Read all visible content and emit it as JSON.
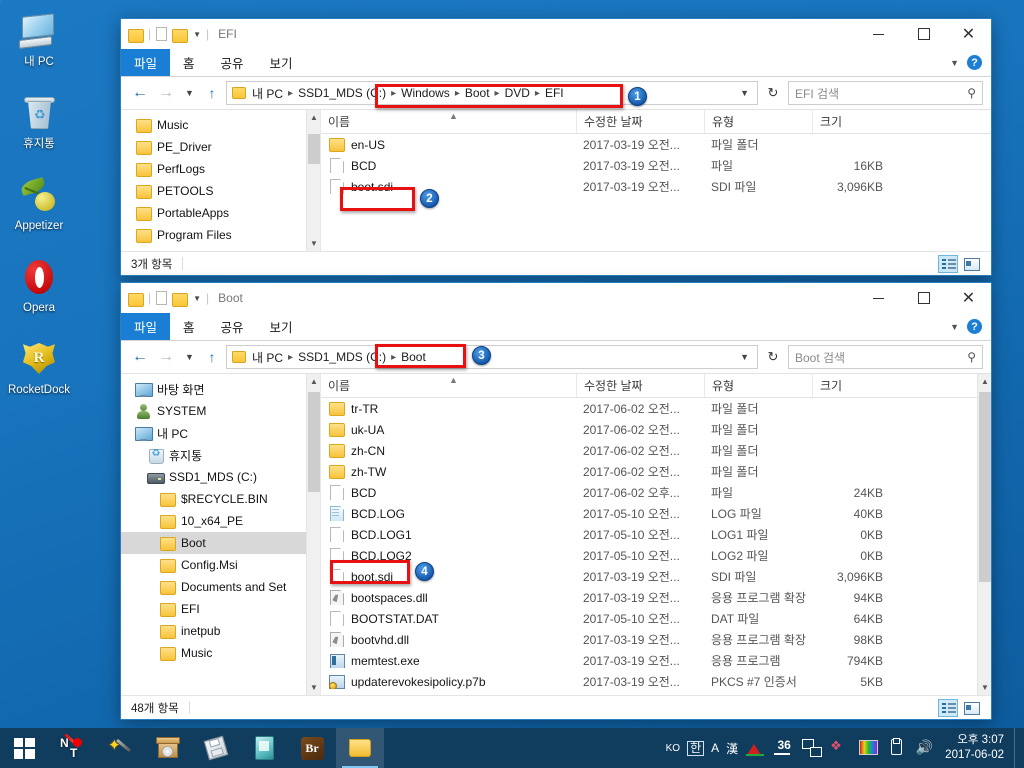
{
  "desktop": {
    "icons": [
      {
        "label": "내 PC",
        "icon": "my-computer-icon"
      },
      {
        "label": "휴지통",
        "icon": "recycle-bin-icon"
      },
      {
        "label": "Appetizer",
        "icon": "appetizer-icon"
      },
      {
        "label": "Opera",
        "icon": "opera-icon"
      },
      {
        "label": "RocketDock",
        "icon": "rocketdock-icon"
      }
    ]
  },
  "ribbon_tabs": [
    "파일",
    "홈",
    "공유",
    "보기"
  ],
  "window_efi": {
    "title": "EFI",
    "search_placeholder": "EFI 검색",
    "breadcrumb": [
      "내 PC",
      "SSD1_MDS (C:)",
      "Windows",
      "Boot",
      "DVD",
      "EFI"
    ],
    "columns": [
      "이름",
      "수정한 날짜",
      "유형",
      "크기"
    ],
    "nav_items": [
      {
        "label": "Music",
        "icon": "folder-icon"
      },
      {
        "label": "PE_Driver",
        "icon": "folder-icon"
      },
      {
        "label": "PerfLogs",
        "icon": "folder-icon"
      },
      {
        "label": "PETOOLS",
        "icon": "folder-icon"
      },
      {
        "label": "PortableApps",
        "icon": "folder-icon"
      },
      {
        "label": "Program Files",
        "icon": "folder-icon"
      }
    ],
    "files": [
      {
        "name": "en-US",
        "date": "2017-03-19 오전...",
        "type": "파일 폴더",
        "size": "",
        "icon": "folder-icon"
      },
      {
        "name": "BCD",
        "date": "2017-03-19 오전...",
        "type": "파일",
        "size": "16KB",
        "icon": "file-icon"
      },
      {
        "name": "boot.sdi",
        "date": "2017-03-19 오전...",
        "type": "SDI 파일",
        "size": "3,096KB",
        "icon": "file-icon"
      }
    ],
    "status": "3개 항목"
  },
  "window_boot": {
    "title": "Boot",
    "search_placeholder": "Boot 검색",
    "breadcrumb": [
      "내 PC",
      "SSD1_MDS (C:)",
      "Boot"
    ],
    "columns": [
      "이름",
      "수정한 날짜",
      "유형",
      "크기"
    ],
    "tree": [
      {
        "label": "바탕 화면",
        "icon": "desktop-icon",
        "indent": 1,
        "selected": false
      },
      {
        "label": "SYSTEM",
        "icon": "user-icon",
        "indent": 1,
        "selected": false
      },
      {
        "label": "내 PC",
        "icon": "my-computer-icon",
        "indent": 1,
        "selected": false
      },
      {
        "label": "휴지통",
        "icon": "recycle-bin-icon",
        "indent": 2,
        "selected": false
      },
      {
        "label": "SSD1_MDS (C:)",
        "icon": "drive-icon",
        "indent": 2,
        "selected": false
      },
      {
        "label": "$RECYCLE.BIN",
        "icon": "folder-icon",
        "indent": 3,
        "selected": false
      },
      {
        "label": "10_x64_PE",
        "icon": "folder-icon",
        "indent": 3,
        "selected": false
      },
      {
        "label": "Boot",
        "icon": "folder-icon",
        "indent": 3,
        "selected": true
      },
      {
        "label": "Config.Msi",
        "icon": "folder-icon",
        "indent": 3,
        "selected": false
      },
      {
        "label": "Documents and Set",
        "icon": "folder-icon",
        "indent": 3,
        "selected": false
      },
      {
        "label": "EFI",
        "icon": "folder-icon",
        "indent": 3,
        "selected": false
      },
      {
        "label": "inetpub",
        "icon": "folder-icon",
        "indent": 3,
        "selected": false
      },
      {
        "label": "Music",
        "icon": "folder-icon",
        "indent": 3,
        "selected": false
      }
    ],
    "files": [
      {
        "name": "tr-TR",
        "date": "2017-06-02 오전...",
        "type": "파일 폴더",
        "size": "",
        "icon": "folder-icon"
      },
      {
        "name": "uk-UA",
        "date": "2017-06-02 오전...",
        "type": "파일 폴더",
        "size": "",
        "icon": "folder-icon"
      },
      {
        "name": "zh-CN",
        "date": "2017-06-02 오전...",
        "type": "파일 폴더",
        "size": "",
        "icon": "folder-icon"
      },
      {
        "name": "zh-TW",
        "date": "2017-06-02 오전...",
        "type": "파일 폴더",
        "size": "",
        "icon": "folder-icon"
      },
      {
        "name": "BCD",
        "date": "2017-06-02 오후...",
        "type": "파일",
        "size": "24KB",
        "icon": "file-icon"
      },
      {
        "name": "BCD.LOG",
        "date": "2017-05-10 오전...",
        "type": "LOG 파일",
        "size": "40KB",
        "icon": "log-icon"
      },
      {
        "name": "BCD.LOG1",
        "date": "2017-05-10 오전...",
        "type": "LOG1 파일",
        "size": "0KB",
        "icon": "file-icon"
      },
      {
        "name": "BCD.LOG2",
        "date": "2017-05-10 오전...",
        "type": "LOG2 파일",
        "size": "0KB",
        "icon": "file-icon"
      },
      {
        "name": "boot.sdi",
        "date": "2017-03-19 오전...",
        "type": "SDI 파일",
        "size": "3,096KB",
        "icon": "file-icon"
      },
      {
        "name": "bootspaces.dll",
        "date": "2017-03-19 오전...",
        "type": "응용 프로그램 확장",
        "size": "94KB",
        "icon": "dll-icon"
      },
      {
        "name": "BOOTSTAT.DAT",
        "date": "2017-05-10 오전...",
        "type": "DAT 파일",
        "size": "64KB",
        "icon": "file-icon"
      },
      {
        "name": "bootvhd.dll",
        "date": "2017-03-19 오전...",
        "type": "응용 프로그램 확장",
        "size": "98KB",
        "icon": "dll-icon"
      },
      {
        "name": "memtest.exe",
        "date": "2017-03-19 오전...",
        "type": "응용 프로그램",
        "size": "794KB",
        "icon": "exe-icon"
      },
      {
        "name": "updaterevokesipolicy.p7b",
        "date": "2017-03-19 오전...",
        "type": "PKCS #7 인증서",
        "size": "5KB",
        "icon": "cert-icon"
      }
    ],
    "status": "48개 항목"
  },
  "callouts": [
    {
      "number": "1",
      "target": "efi-breadcrumb"
    },
    {
      "number": "2",
      "target": "efi-bootsdi-row"
    },
    {
      "number": "3",
      "target": "boot-breadcrumb"
    },
    {
      "number": "4",
      "target": "boot-bootsdi-row"
    }
  ],
  "taskbar": {
    "items": [
      {
        "name": "notepad-taskbar-icon"
      },
      {
        "name": "magic-wand-taskbar-icon"
      },
      {
        "name": "cd-box-taskbar-icon"
      },
      {
        "name": "floppy-taskbar-icon"
      },
      {
        "name": "teal-app-taskbar-icon"
      },
      {
        "name": "bridge-taskbar-icon"
      },
      {
        "name": "explorer-taskbar-icon"
      }
    ],
    "ime": {
      "lang": "KO",
      "hangul": "한",
      "alpha": "A",
      "hanja": "漢"
    },
    "tray_count": "36",
    "clock_time": "오후 3:07",
    "clock_date": "2017-06-02"
  },
  "colors": {
    "accent": "#1a7fd4",
    "highlight_red": "#e81010",
    "badge_blue": "#1154a8",
    "taskbar": "#103c5e",
    "desktop": "#1874bd"
  }
}
